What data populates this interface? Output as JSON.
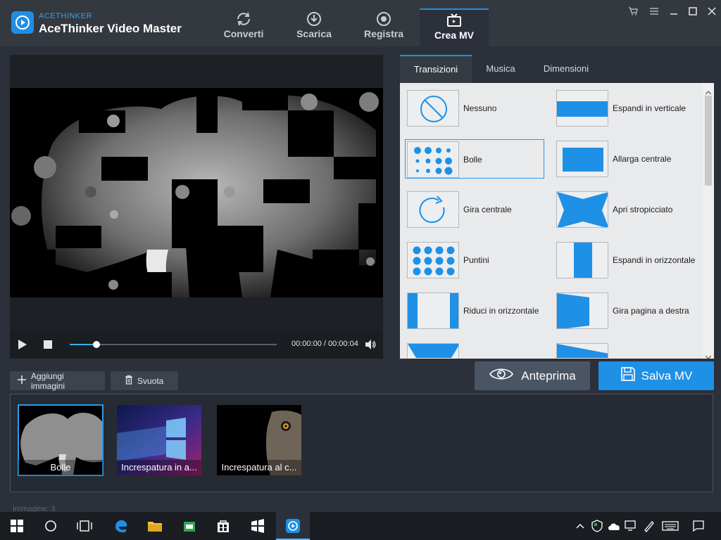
{
  "app": {
    "brand_small": "ACETHINKER",
    "title": "AceThinker Video Master",
    "accent_color": "#1e90e6"
  },
  "nav": {
    "tabs": [
      {
        "label": "Converti",
        "icon": "refresh-icon"
      },
      {
        "label": "Scarica",
        "icon": "download-icon"
      },
      {
        "label": "Registra",
        "icon": "record-icon"
      },
      {
        "label": "Crea MV",
        "icon": "tv-icon",
        "active": true
      }
    ]
  },
  "window_controls": [
    "cart-icon",
    "menu-icon",
    "minimize-icon",
    "maximize-icon",
    "close-icon"
  ],
  "player": {
    "time": "00:00:00 / 00:00:04",
    "progress": 0.13
  },
  "panel": {
    "tabs": [
      {
        "label": "Transizioni",
        "active": true
      },
      {
        "label": "Musica"
      },
      {
        "label": "Dimensioni"
      }
    ],
    "transitions": [
      {
        "label": "Nessuno",
        "icon": "none-icon"
      },
      {
        "label": "Espandi in verticale",
        "icon": "expand-vertical-icon"
      },
      {
        "label": "Bolle",
        "icon": "bubbles-icon",
        "selected": true
      },
      {
        "label": "Allarga centrale",
        "icon": "center-widen-icon"
      },
      {
        "label": "Gira centrale",
        "icon": "rotate-center-icon"
      },
      {
        "label": "Apri stropicciato",
        "icon": "crumple-open-icon"
      },
      {
        "label": "Puntini",
        "icon": "dots-icon"
      },
      {
        "label": "Espandi in orizzontale",
        "icon": "expand-horizontal-icon"
      },
      {
        "label": "Riduci in orizzontale",
        "icon": "shrink-horizontal-icon"
      },
      {
        "label": "Gira pagina a destra",
        "icon": "page-turn-right-icon"
      }
    ]
  },
  "actions": {
    "preview_label": "Anteprima",
    "save_label": "Salva MV",
    "add_images_label": "Aggiungi immagini",
    "clear_label": "Svuota"
  },
  "strip": {
    "items": [
      {
        "caption": "Bolle",
        "selected": true
      },
      {
        "caption": "Increspatura in a..."
      },
      {
        "caption": "Increspatura al c..."
      }
    ]
  },
  "status": {
    "text": "Immagine: 3"
  }
}
